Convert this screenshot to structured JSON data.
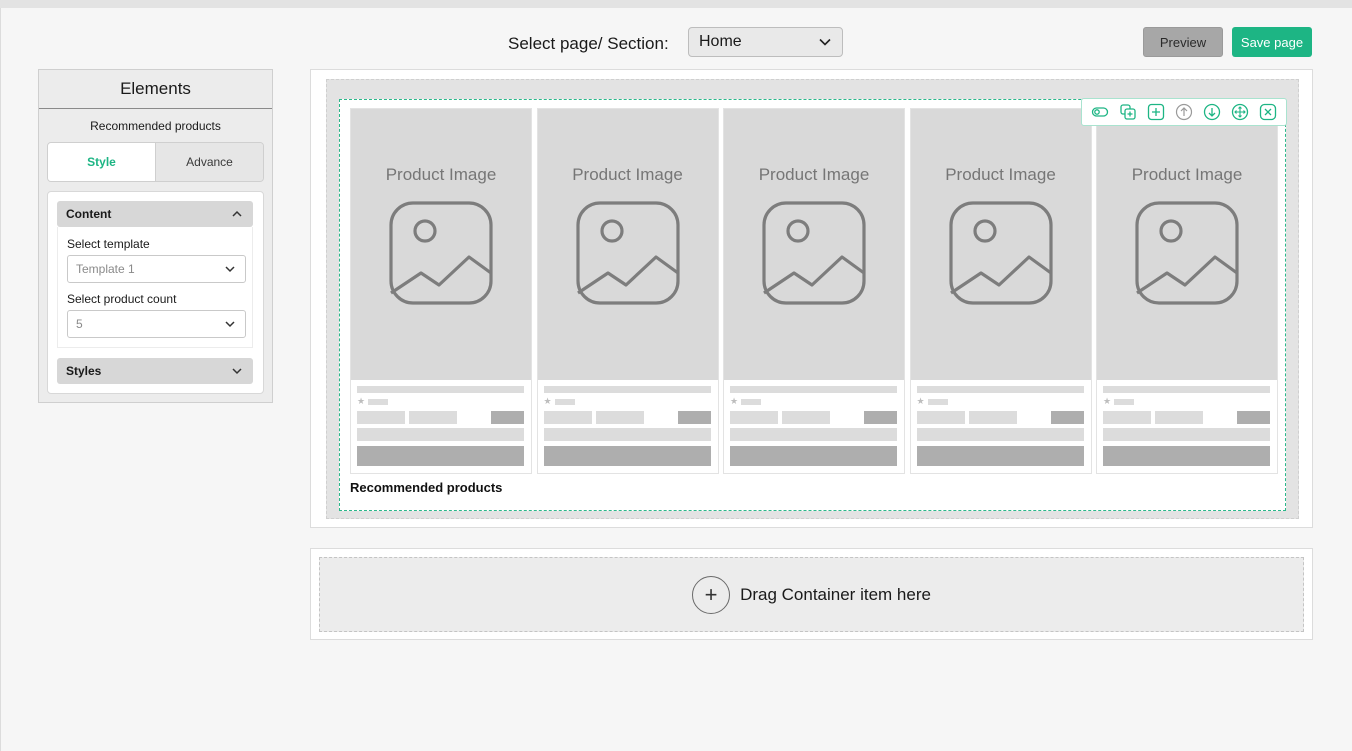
{
  "header": {
    "section_label": "Select page/ Section:",
    "page_select_value": "Home",
    "preview_label": "Preview",
    "save_label": "Save page"
  },
  "panel": {
    "title": "Elements",
    "subtitle": "Recommended products",
    "tabs": [
      {
        "label": "Style",
        "active": true
      },
      {
        "label": "Advance",
        "active": false
      }
    ],
    "content_title": "Content",
    "template_label": "Select template",
    "template_value": "Template 1",
    "count_label": "Select product count",
    "count_value": "5",
    "styles_title": "Styles"
  },
  "canvas": {
    "section_label": "Recommended products",
    "product_image_label": "Product Image",
    "product_count": 5,
    "toolbar_icons": [
      "toggle-visibility-icon",
      "duplicate-icon",
      "add-icon",
      "move-up-icon",
      "move-down-icon",
      "move-icon",
      "close-icon"
    ]
  },
  "dropzone": {
    "text": "Drag Container item here"
  },
  "colors": {
    "accent": "#1db584",
    "preview_bg": "#a7a7a7",
    "section_border": "#2bb88a"
  }
}
